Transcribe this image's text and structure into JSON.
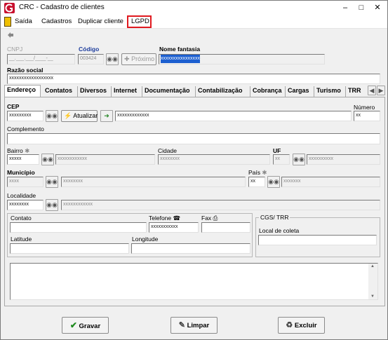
{
  "window": {
    "title": "CRC - Cadastro de clientes"
  },
  "menu": {
    "exit": "Saída",
    "records": "Cadastros",
    "duplicate": "Duplicar cliente",
    "lgpd": "LGPD"
  },
  "header": {
    "cnpj_label": "CNPJ",
    "cnpj_value": "__.___.___/____-__",
    "code_label": "Código",
    "code_value": "003424",
    "next_label": "Próximo",
    "trade_name_label": "Nome fantasia",
    "trade_name_value": "xxxxxxxxxxxxxxxx",
    "company_name_label": "Razão social",
    "company_name_value": "xxxxxxxxxxxxxxxxxx"
  },
  "tabs": [
    "Endereço",
    "Contatos",
    "Diversos",
    "Internet",
    "Documentação",
    "Contabilização",
    "Cobrança",
    "Cargas",
    "Turismo",
    "TRR"
  ],
  "address": {
    "cep_label": "CEP",
    "cep_value": "xxxxxxxxx",
    "update_label": "Atualizar",
    "street_value": "xxxxxxxxxxxxx",
    "number_label": "Número",
    "number_value": "xx",
    "complement_label": "Complemento",
    "district_label": "Bairro",
    "district_code": "xxxxx",
    "district_name": "xxxxxxxxxxxx",
    "city_label": "Cidade",
    "city_value": "xxxxxxxx",
    "uf_label": "UF",
    "uf_code": "xx",
    "uf_name": "xxxxxxxxxx",
    "municipality_label": "Município",
    "municipality_code": "xxxx",
    "municipality_name": "xxxxxxxx",
    "country_label": "País",
    "country_code": "xx",
    "country_name": "xxxxxxx",
    "locality_label": "Localidade",
    "locality_code": "xxxxxxxx",
    "locality_name": "xxxxxxxxxxxx",
    "contact_label": "Contato",
    "phone_label": "Telefone",
    "phone_value": "xxxxxxxxxxx",
    "fax_label": "Fax",
    "cgs_group_label": "CGS/ TRR",
    "collection_place_label": "Local de coleta",
    "latitude_label": "Latitude",
    "longitude_label": "Longitude"
  },
  "footer": {
    "save": "Gravar",
    "clear": "Limpar",
    "delete": "Excluir"
  },
  "colors": {
    "lgpd_highlight": "#e0191f",
    "selection": "#1c4fbf",
    "code_label": "#1c3c9c"
  }
}
